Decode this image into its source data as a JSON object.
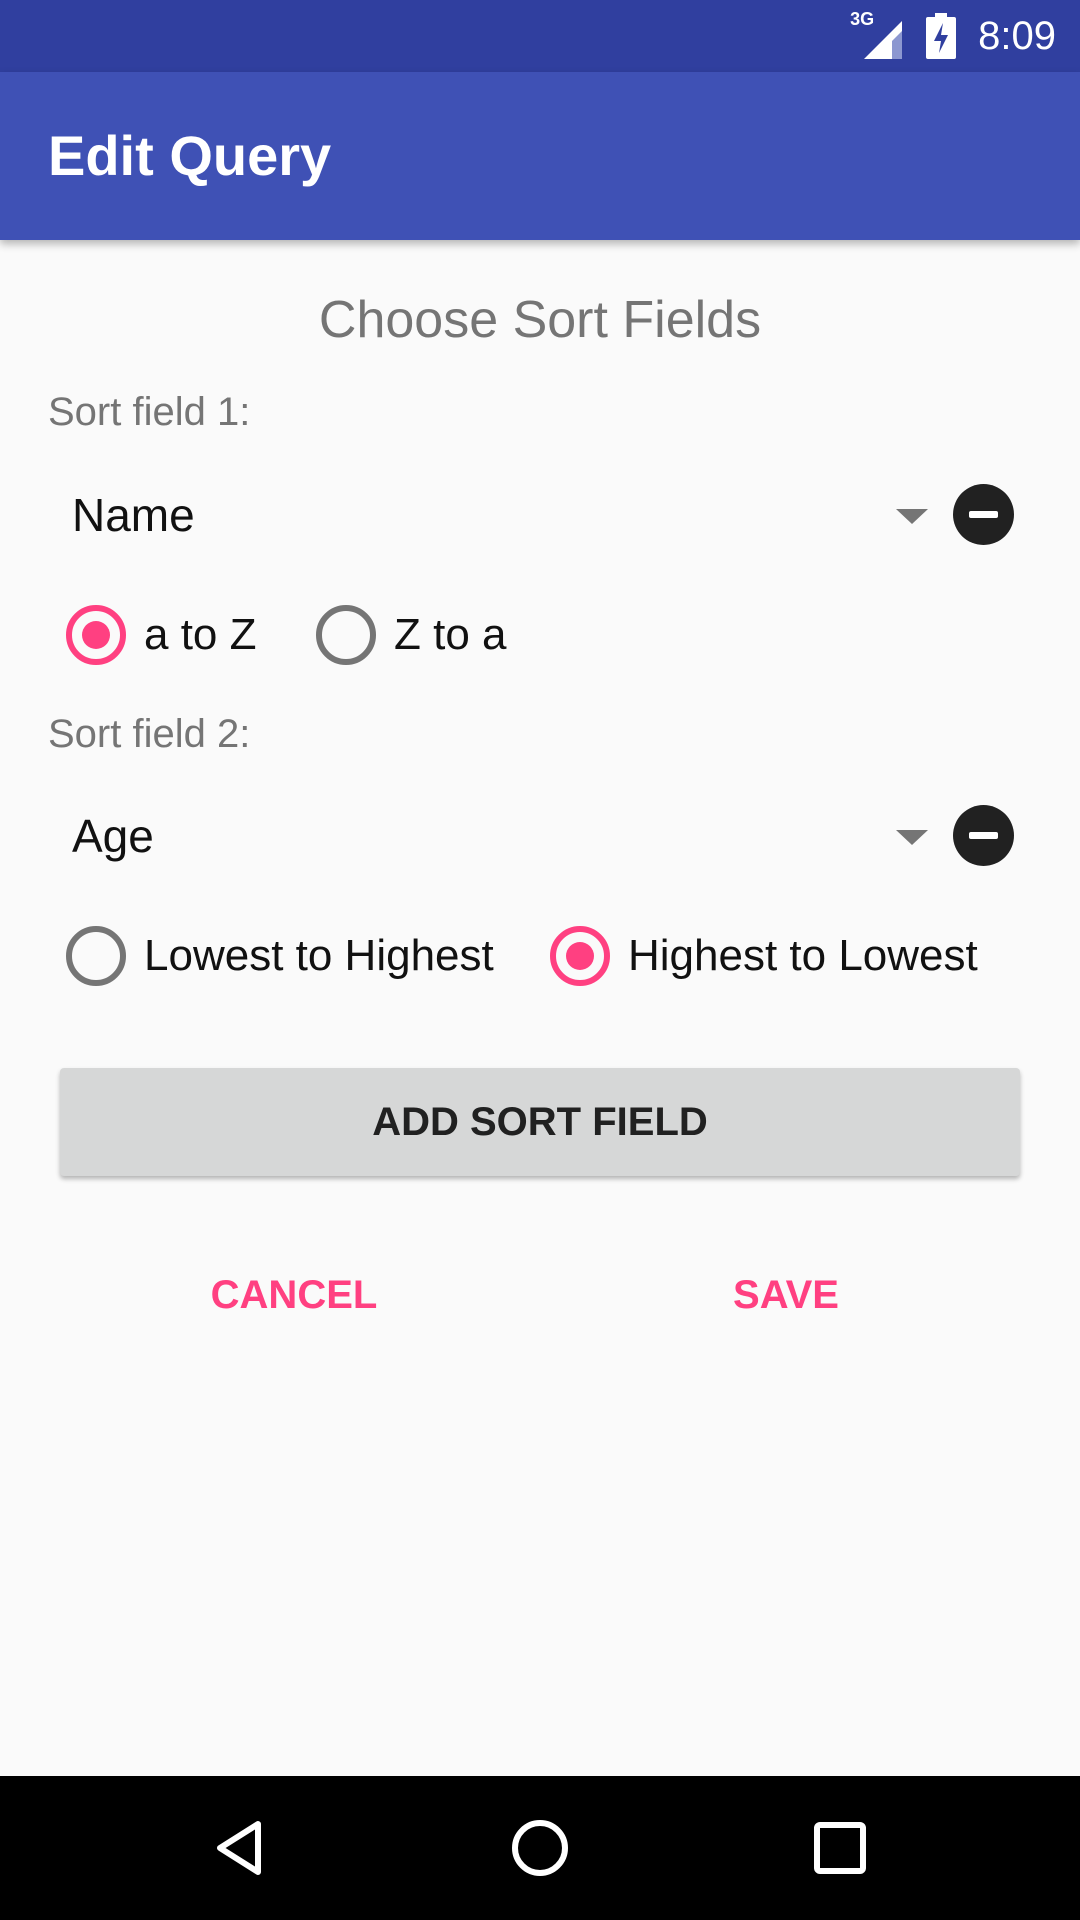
{
  "status_bar": {
    "network": "3G",
    "time": "8:09"
  },
  "app_bar": {
    "title": "Edit Query"
  },
  "heading": "Choose Sort Fields",
  "sort_fields": [
    {
      "label": "Sort field 1:",
      "value": "Name",
      "options": [
        {
          "label": "a to Z",
          "checked": true
        },
        {
          "label": "Z to a",
          "checked": false
        }
      ]
    },
    {
      "label": "Sort field 2:",
      "value": "Age",
      "options": [
        {
          "label": "Lowest to Highest",
          "checked": false
        },
        {
          "label": "Highest to Lowest",
          "checked": true
        }
      ]
    }
  ],
  "actions": {
    "add_label": "ADD SORT FIELD",
    "cancel_label": "CANCEL",
    "save_label": "SAVE"
  },
  "colors": {
    "primary": "#3f51b5",
    "primary_dark": "#303f9f",
    "accent": "#ff4081"
  },
  "nav_icons": [
    "back-icon",
    "home-icon",
    "recents-icon"
  ]
}
